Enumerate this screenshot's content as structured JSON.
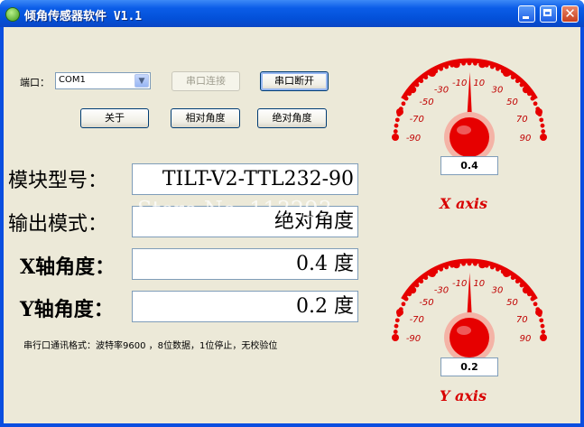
{
  "window": {
    "title": "倾角传感器软件 V1.1",
    "close_glyph": "✕"
  },
  "port": {
    "label": "端口：",
    "selected": "COM1",
    "connect_label": "串口连接",
    "disconnect_label": "串口断开"
  },
  "actions": {
    "about_label": "关于",
    "relative_label": "相对角度",
    "absolute_label": "绝对角度"
  },
  "info": {
    "model_label": "模块型号：",
    "model_value": "TILT-V2-TTL232-90",
    "mode_label": "输出模式：",
    "mode_value": "绝对角度",
    "x_label": "X轴角度：",
    "x_value": "0.4 度",
    "y_label": "Y轴角度：",
    "y_value": "0.2 度"
  },
  "note": "串行口通讯格式：波特率9600 ，8位数据，1位停止，无校验位",
  "watermark": "Store No. 113293",
  "gauges": [
    {
      "name": "x",
      "value": 0.4,
      "readout": "0.4",
      "label": "X axis",
      "ticks": [
        "-90",
        "-70",
        "-50",
        "-30",
        "-10",
        "10",
        "30",
        "50",
        "70",
        "90"
      ]
    },
    {
      "name": "y",
      "value": 0.2,
      "readout": "0.2",
      "label": "Y axis",
      "ticks": [
        "-90",
        "-70",
        "-50",
        "-30",
        "-10",
        "10",
        "30",
        "50",
        "70",
        "90"
      ]
    }
  ],
  "colors": {
    "gauge_red": "#e60000",
    "titlebar": "#0a55e0",
    "face": "#ece9d8"
  }
}
